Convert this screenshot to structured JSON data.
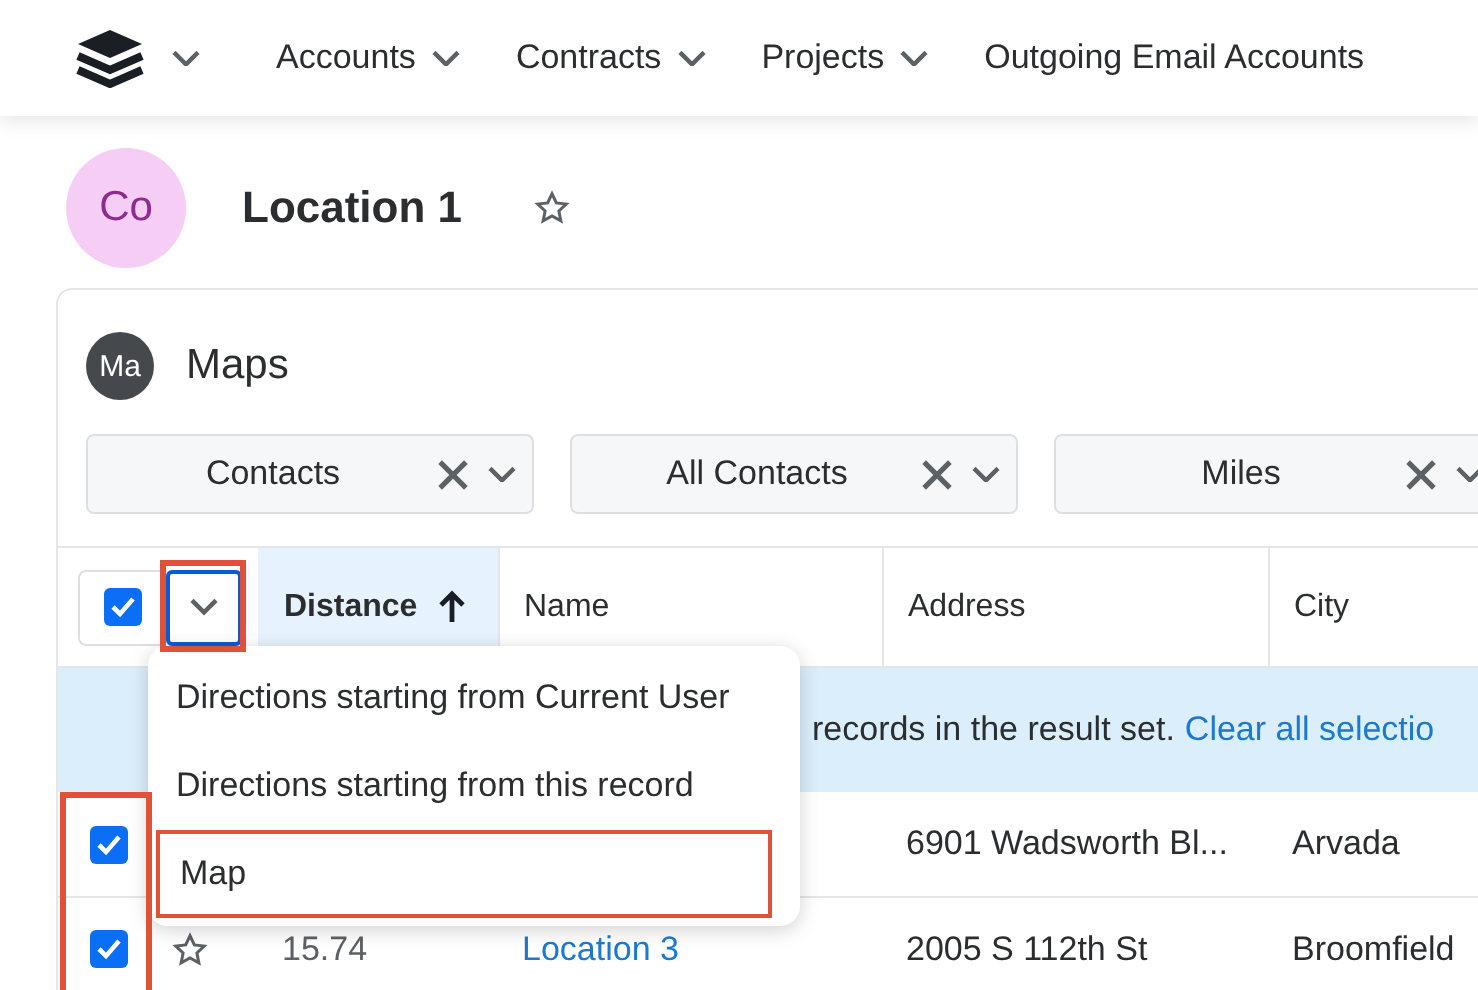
{
  "nav": {
    "items": [
      {
        "label": "Accounts",
        "dropdown": true
      },
      {
        "label": "Contracts",
        "dropdown": true
      },
      {
        "label": "Projects",
        "dropdown": true
      },
      {
        "label": "Outgoing Email Accounts",
        "dropdown": false
      }
    ]
  },
  "record": {
    "avatar": "Co",
    "title": "Location 1",
    "favorite": false
  },
  "dashlet": {
    "avatar": "Ma",
    "title": "Maps",
    "filters": [
      {
        "value": "Contacts"
      },
      {
        "value": "All Contacts"
      },
      {
        "value": "Miles"
      }
    ],
    "table": {
      "select_all_checked": true,
      "actions_highlighted": true,
      "checkbox_column_highlighted": true,
      "columns": [
        {
          "label": "Distance",
          "sorted": true
        },
        {
          "label": "Name",
          "sorted": false
        },
        {
          "label": "Address",
          "sorted": false
        },
        {
          "label": "City",
          "sorted": false
        }
      ],
      "banner": {
        "text": "records in the result set.",
        "link": "Clear all selectio"
      },
      "rows": [
        {
          "checked": true,
          "address": "6901 Wadsworth Bl...",
          "city": "Arvada"
        },
        {
          "checked": true,
          "favorite": false,
          "distance": "15.74",
          "name": "Location 3",
          "address": "2005 S 112th St",
          "city": "Broomfield"
        }
      ]
    },
    "menu": {
      "items": [
        {
          "label": "Directions starting from Current User",
          "highlighted": false
        },
        {
          "label": "Directions starting from this record",
          "highlighted": false
        },
        {
          "label": "Map",
          "highlighted": true
        }
      ]
    }
  }
}
